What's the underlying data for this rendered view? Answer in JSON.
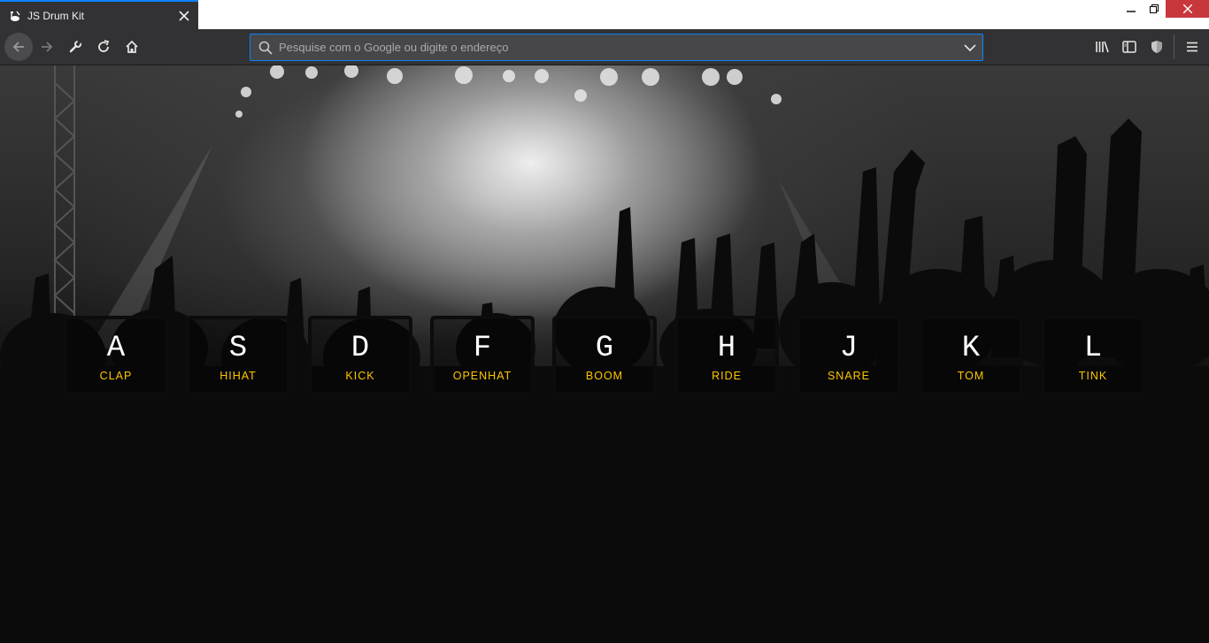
{
  "browser": {
    "tab_title": "JS Drum Kit",
    "url_placeholder": "Pesquise com o Google ou digite o endereço",
    "accent_color": "#0a84ff",
    "toolbar_icons": [
      "back-arrow-icon",
      "forward-arrow-icon",
      "wrench-icon",
      "reload-icon",
      "home-icon",
      "library-icon",
      "sidebar-icon",
      "shield-icon",
      "hamburger-menu-icon"
    ]
  },
  "drumkit": {
    "accent_color": "#ffc600",
    "keys": [
      {
        "letter": "A",
        "sound": "CLAP"
      },
      {
        "letter": "S",
        "sound": "HIHAT"
      },
      {
        "letter": "D",
        "sound": "KICK"
      },
      {
        "letter": "F",
        "sound": "OPENHAT"
      },
      {
        "letter": "G",
        "sound": "BOOM"
      },
      {
        "letter": "H",
        "sound": "RIDE"
      },
      {
        "letter": "J",
        "sound": "SNARE"
      },
      {
        "letter": "K",
        "sound": "TOM"
      },
      {
        "letter": "L",
        "sound": "TINK"
      }
    ]
  }
}
